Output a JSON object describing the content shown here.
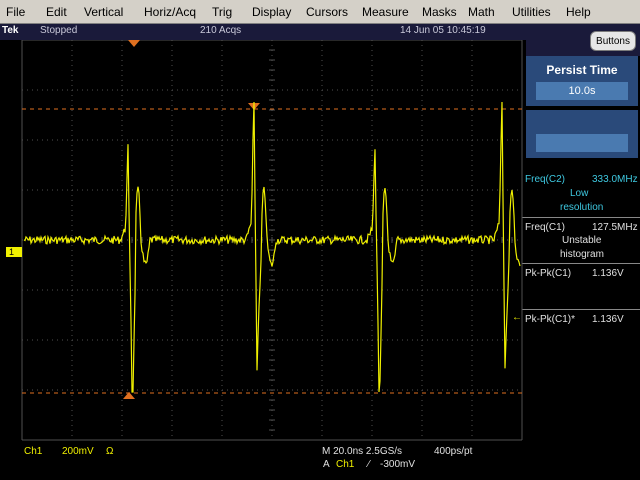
{
  "menu": [
    {
      "label": "File"
    },
    {
      "label": "Edit"
    },
    {
      "label": "Vertical"
    },
    {
      "label": "Horiz/Acq"
    },
    {
      "label": "Trig"
    },
    {
      "label": "Display"
    },
    {
      "label": "Cursors"
    },
    {
      "label": "Measure"
    },
    {
      "label": "Masks"
    },
    {
      "label": "Math"
    },
    {
      "label": "Utilities"
    },
    {
      "label": "Help"
    }
  ],
  "status": {
    "logo": "Tek",
    "state": "Stopped",
    "acqs": "210 Acqs",
    "datetime": "14 Jun 05 10:45:19"
  },
  "buttons_label": "Buttons",
  "persist": {
    "title": "Persist Time",
    "value": "10.0s"
  },
  "measurements": {
    "freq_c2": {
      "label": "Freq(C2)",
      "value": "333.0MHz",
      "note1": "Low",
      "note2": "resolution"
    },
    "freq_c1": {
      "label": "Freq(C1)",
      "value": "127.5MHz",
      "note1": "Unstable",
      "note2": "histogram"
    },
    "pkpk_c1": {
      "label": "Pk-Pk(C1)",
      "value": "1.136V"
    },
    "pkpk_c1_star": {
      "label": "Pk-Pk(C1)*",
      "value": "1.136V"
    }
  },
  "bottom": {
    "channel": "Ch1",
    "scale": "200mV",
    "ohm": "Ω",
    "timebase": "M 20.0ns 2.5GS/s",
    "pts": "400ps/pt",
    "trigger_prefix": "A",
    "trigger_ch": "Ch1",
    "trigger_slope": "⁄",
    "trigger_level": "-300mV"
  },
  "channel_marker": "1",
  "colors": {
    "trace": "#f0f000",
    "cursor": "#e07020",
    "grid": "#505050",
    "panel": "#2a4a7a"
  }
}
